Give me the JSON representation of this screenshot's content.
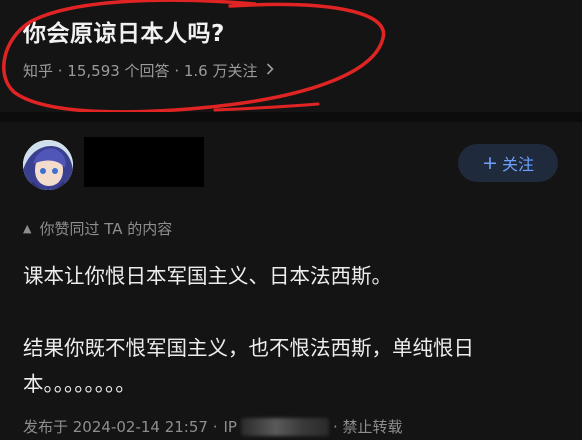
{
  "question": {
    "title": "你会原谅日本人吗?",
    "meta": "知乎 · 15,593 个回答 · 1.6 万关注",
    "meta_chevron_icon": "chevron-right-icon"
  },
  "annotation": {
    "color": "#e02424",
    "shape": "hand-drawn-circle"
  },
  "author": {
    "avatar_icon": "anime-avatar",
    "name_redacted": true
  },
  "follow_button": {
    "label": "关注",
    "icon": "plus-icon",
    "color": "#6ea1ff"
  },
  "upvote_notice": {
    "icon": "upvote-triangle-icon",
    "text": "你赞同过 TA 的内容"
  },
  "answer": {
    "paragraphs": [
      "课本让你恨日本军国主义、日本法西斯。",
      "结果你既不恨军国主义，也不恨法西斯，单纯恨日本。。。。。。。。"
    ]
  },
  "footer": {
    "published": "发布于 2024-02-14 21:57 ·",
    "location_prefix": "IP",
    "policy": "· 禁止转载"
  }
}
